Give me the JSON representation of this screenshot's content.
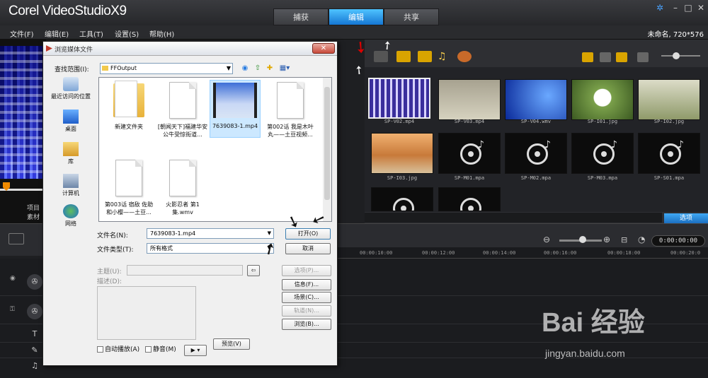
{
  "app": {
    "logo": "Corel VideoStudioX9"
  },
  "tabs": [
    {
      "label": "捕获"
    },
    {
      "label": "编辑"
    },
    {
      "label": "共享"
    }
  ],
  "menu": [
    {
      "label": "文件(F)"
    },
    {
      "label": "编辑(E)"
    },
    {
      "label": "工具(T)"
    },
    {
      "label": "设置(S)"
    },
    {
      "label": "帮助(H)"
    }
  ],
  "project_info": "未命名, 720*576",
  "left_panel": {
    "label1": "项目",
    "label2": "素材"
  },
  "library": {
    "items": [
      {
        "caption": "SP-V02.mp4"
      },
      {
        "caption": "SP-V03.mp4"
      },
      {
        "caption": "SP-V04.wmv"
      },
      {
        "caption": "SP-I01.jpg"
      },
      {
        "caption": "SP-I02.jpg"
      },
      {
        "caption": "SP-I03.jpg"
      },
      {
        "caption": "SP-M01.mpa"
      },
      {
        "caption": "SP-M02.mpa"
      },
      {
        "caption": "SP-M03.mpa"
      },
      {
        "caption": "SP-S01.mpa"
      }
    ],
    "options_label": "选项"
  },
  "timeline": {
    "timecode": "0:00:00:00",
    "ruler": [
      "00:00:10:00",
      "00:00:12:00",
      "00:00:14:00",
      "00:00:16:00",
      "00:00:18:00",
      "00:00:20:0"
    ]
  },
  "dialog": {
    "title": "浏览媒体文件",
    "look_in_label": "查找范围(I):",
    "look_in_value": "FFOutput",
    "places": [
      {
        "label": "最近访问的位置"
      },
      {
        "label": "桌面"
      },
      {
        "label": "库"
      },
      {
        "label": "计算机"
      },
      {
        "label": "网络"
      }
    ],
    "files": [
      {
        "name": "新建文件夹"
      },
      {
        "name": "[朝闻天下]福建华安 公牛受惊街道..."
      },
      {
        "name": "7639083-1.mp4"
      },
      {
        "name": "第002话 我是木叶丸——土豆视频..."
      },
      {
        "name": "第003话 宿敌 佐助和小樱——土豆..."
      },
      {
        "name": "火影忍者 第1集.wmv"
      }
    ],
    "filename_label": "文件名(N):",
    "filename_value": "7639083-1.mp4",
    "filetype_label": "文件类型(T):",
    "filetype_value": "所有格式",
    "open_button": "打开(O)",
    "cancel_button": "取消",
    "subject_label": "主题(U):",
    "desc_label": "描述(D):",
    "options_button": "选项(P)...",
    "info_button": "信息(F)...",
    "scene_button": "场景(C)...",
    "track_button": "轨道(N)...",
    "browse_button": "浏览(B)...",
    "autoplay_label": "自动播放(A)",
    "mute_label": "静音(M)",
    "preview_button": "预览(V)"
  },
  "watermark": {
    "text": "Bai 经验",
    "url": "jingyan.baidu.com"
  },
  "colors": {
    "accent": "#1b8fe8",
    "dialog_bg": "#f0f0f0",
    "close_red": "#c84a3a"
  }
}
